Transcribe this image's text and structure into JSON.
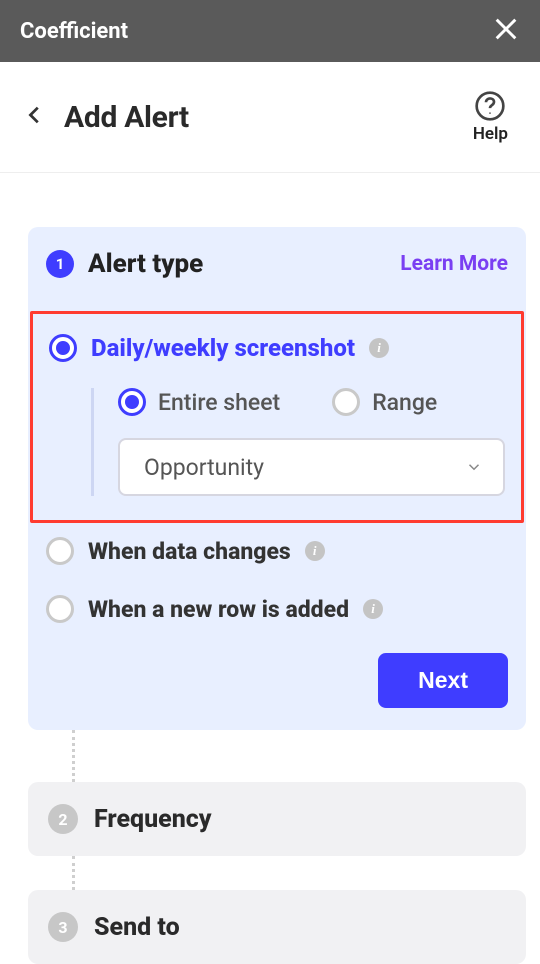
{
  "topbar": {
    "title": "Coefficient"
  },
  "header": {
    "title": "Add Alert",
    "help": "Help"
  },
  "step1": {
    "number": "1",
    "title": "Alert type",
    "learn_more": "Learn More",
    "opt_screenshot": "Daily/weekly screenshot",
    "sub_entire": "Entire sheet",
    "sub_range": "Range",
    "select_value": "Opportunity",
    "opt_changes": "When data changes",
    "opt_newrow": "When a new row is added",
    "next": "Next"
  },
  "step2": {
    "number": "2",
    "title": "Frequency"
  },
  "step3": {
    "number": "3",
    "title": "Send to"
  }
}
